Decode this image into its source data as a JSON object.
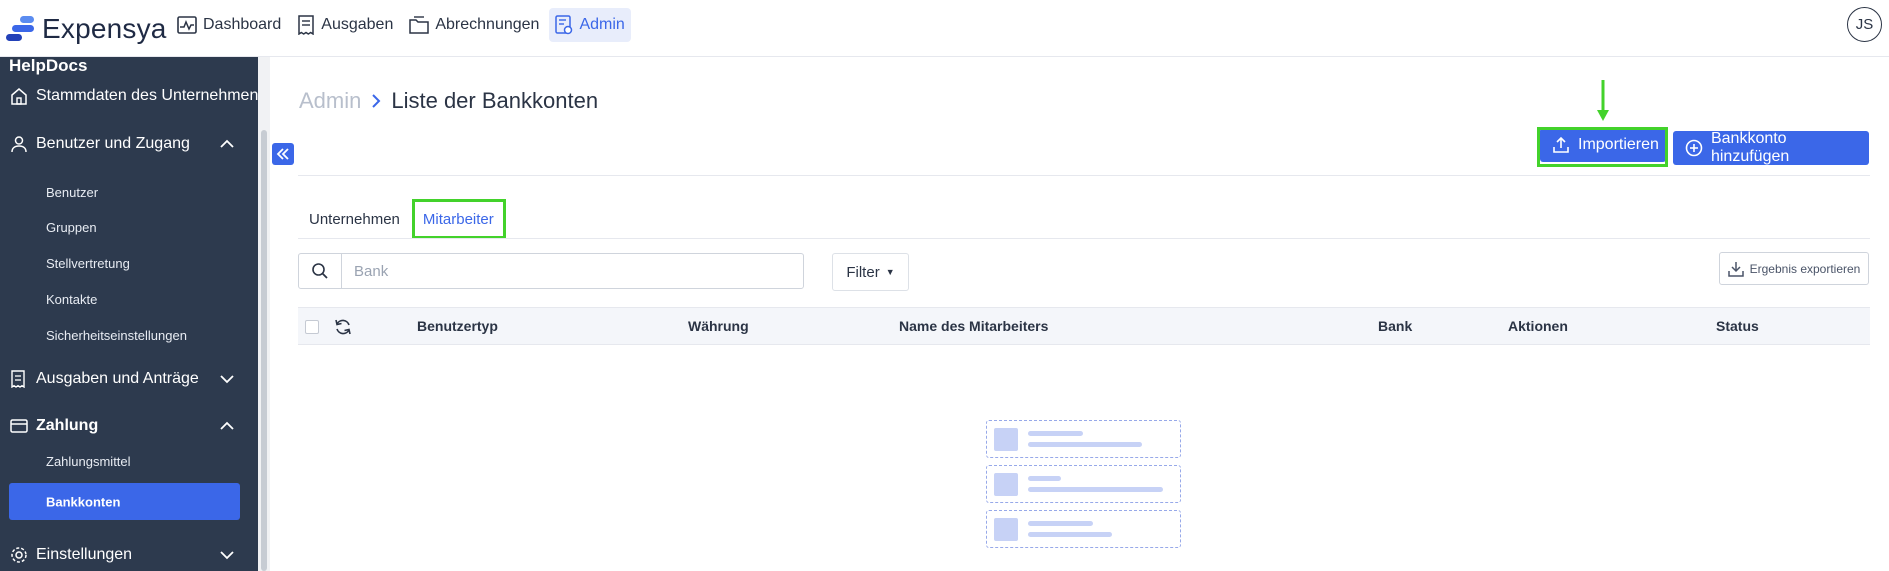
{
  "app": {
    "name": "Expensya"
  },
  "nav": {
    "dashboard": "Dashboard",
    "ausgaben": "Ausgaben",
    "abrechnungen": "Abrechnungen",
    "admin": "Admin"
  },
  "user": {
    "initials": "JS"
  },
  "sidebar": {
    "helpdocs": "HelpDocs",
    "stammdaten": "Stammdaten des Unternehmens",
    "benutzer_zugang": "Benutzer und Zugang",
    "sub_benutzer": [
      "Benutzer",
      "Gruppen",
      "Stellvertretung",
      "Kontakte",
      "Sicherheitseinstellungen"
    ],
    "ausgaben_antraege": "Ausgaben und Anträge",
    "zahlung": "Zahlung",
    "sub_zahlung": [
      "Zahlungsmittel",
      "Bankkonten"
    ],
    "einstellungen": "Einstellungen"
  },
  "breadcrumb": {
    "root": "Admin",
    "current": "Liste der Bankkonten"
  },
  "actions": {
    "import": "Importieren",
    "add_account": "Bankkonto hinzufügen",
    "export": "Ergebnis exportieren",
    "filter": "Filter"
  },
  "tabs": [
    "Unternehmen",
    "Mitarbeiter"
  ],
  "search": {
    "placeholder": "Bank"
  },
  "table": {
    "columns": [
      "Benutzertyp",
      "Währung",
      "Name des Mitarbeiters",
      "Bank",
      "Aktionen",
      "Status"
    ]
  },
  "colors": {
    "accent": "#3b67e8",
    "highlight": "#43d22b",
    "sidebar_bg": "#2d3a4e"
  }
}
